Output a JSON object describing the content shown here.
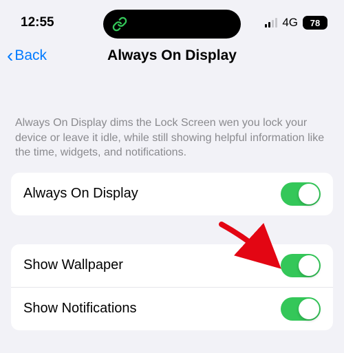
{
  "status": {
    "time": "12:55",
    "network": "4G",
    "battery": "78"
  },
  "nav": {
    "back_label": "Back",
    "title": "Always On Display"
  },
  "description": "Always On Display dims the Lock Screen wen you lock your device or leave it idle, while still showing helpful information like the time, widgets, and notifications.",
  "group1": {
    "always_on": {
      "label": "Always On Display",
      "enabled": true
    }
  },
  "group2": {
    "wallpaper": {
      "label": "Show Wallpaper",
      "enabled": true
    },
    "notifications": {
      "label": "Show Notifications",
      "enabled": true
    }
  }
}
